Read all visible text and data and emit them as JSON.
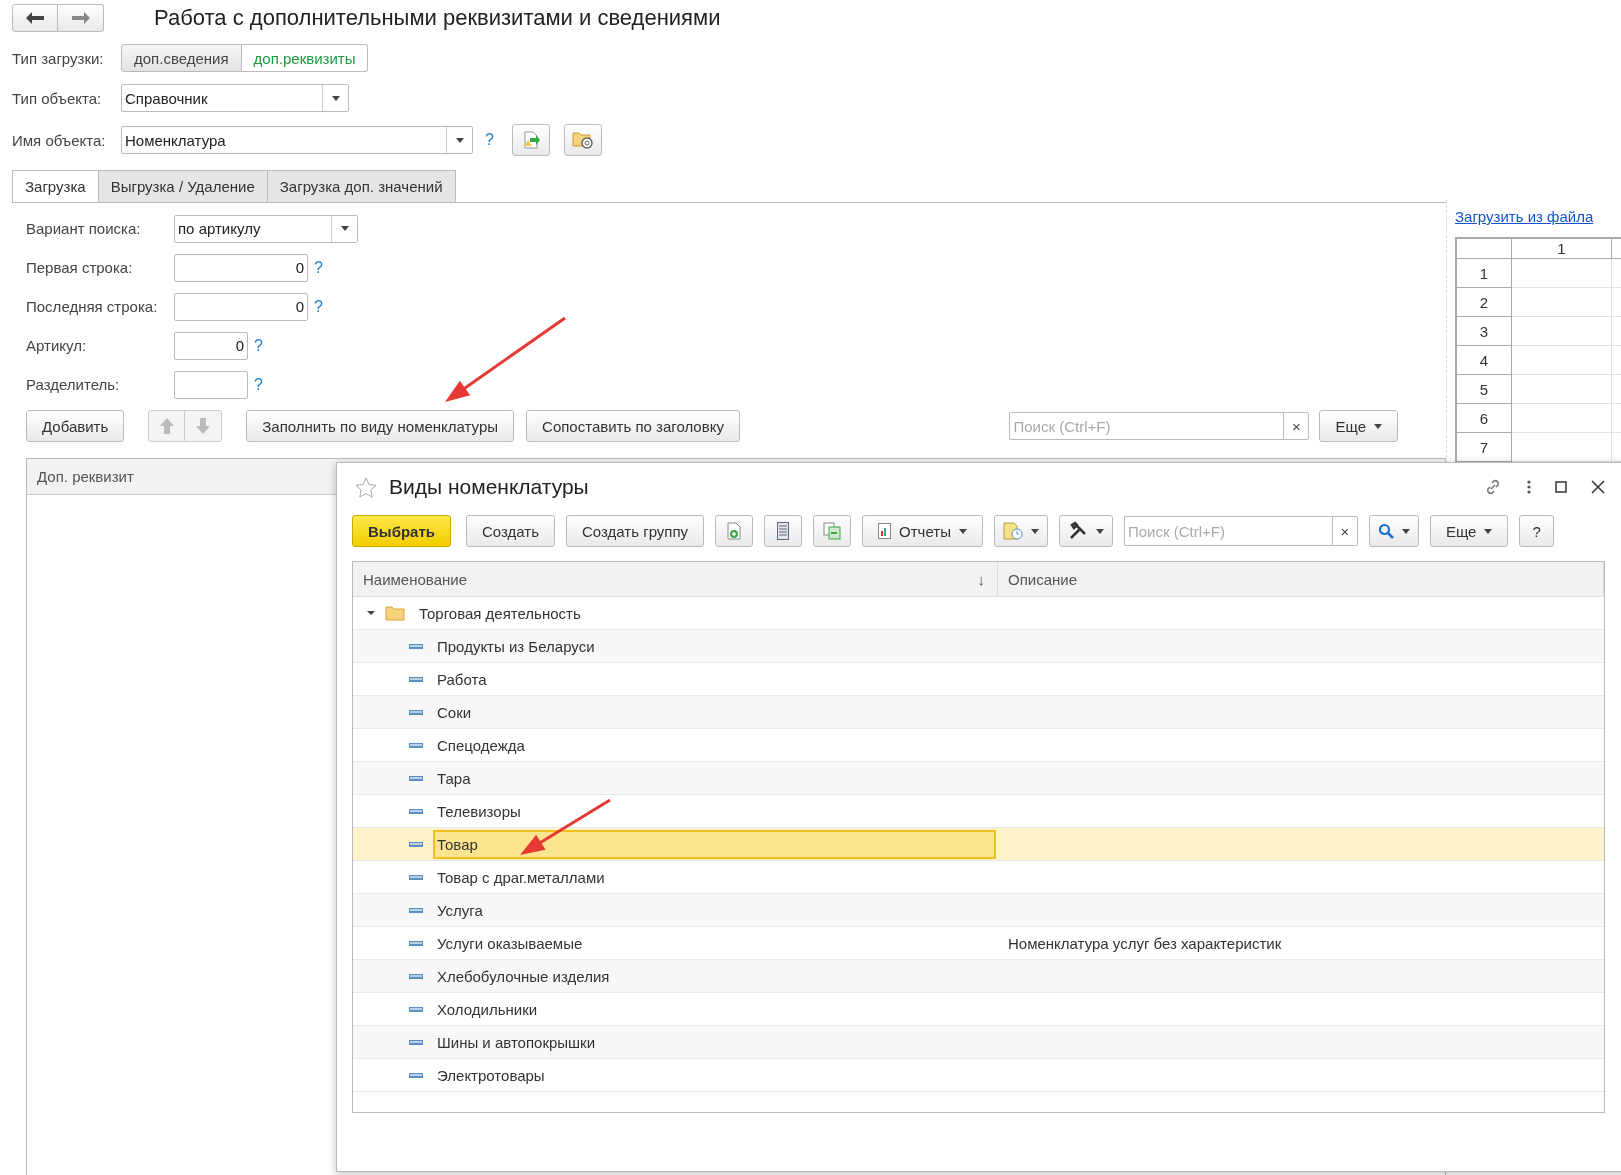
{
  "window": {
    "title": "Работа с дополнительными реквизитами и сведениями"
  },
  "load_type": {
    "label": "Тип загрузки:",
    "options": [
      {
        "label": "доп.сведения",
        "selected": false
      },
      {
        "label": "доп.реквизиты",
        "selected": true
      }
    ]
  },
  "object_type": {
    "label": "Тип объекта:",
    "value": "Справочник"
  },
  "object_name": {
    "label": "Имя объекта:",
    "value": "Номенклатура",
    "help": "?"
  },
  "tabs": [
    {
      "label": "Загрузка",
      "selected": true
    },
    {
      "label": "Выгрузка / Удаление",
      "selected": false
    },
    {
      "label": "Загрузка доп. значений",
      "selected": false
    }
  ],
  "fields": [
    {
      "kind": "select",
      "label": "Вариант поиска:",
      "value": "по артикулу"
    },
    {
      "kind": "number",
      "label": "Первая строка:",
      "value": "0",
      "help": "?"
    },
    {
      "kind": "number",
      "label": "Последняя строка:",
      "value": "0",
      "help": "?"
    },
    {
      "kind": "short",
      "label": "Артикул:",
      "value": "0",
      "help": "?"
    },
    {
      "kind": "short",
      "label": "Разделитель:",
      "help": "?"
    }
  ],
  "actions": {
    "add": "Добавить",
    "fill": "Заполнить по виду номенклатуры",
    "match": "Сопоставить по заголовку"
  },
  "search": {
    "placeholder": "Поиск (Ctrl+F)",
    "clear": "×"
  },
  "more": "Еще",
  "table": {
    "columns": [
      "Доп. реквизит"
    ]
  },
  "sheet": {
    "link": "Загрузить из файла",
    "column": "1",
    "rows": [
      "1",
      "2",
      "3",
      "4",
      "5",
      "6",
      "7"
    ]
  },
  "dialog": {
    "title": "Виды номенклатуры",
    "toolbar": {
      "choose": "Выбрать",
      "create": "Создать",
      "create_group": "Создать группу",
      "reports": "Отчеты",
      "more": "Еще",
      "help": "?"
    },
    "search": {
      "placeholder": "Поиск (Ctrl+F)",
      "clear": "×"
    },
    "columns": [
      "Наименование",
      "Описание"
    ],
    "sort": "↓",
    "tree": [
      {
        "name": "Торговая деятельность",
        "expanded": true,
        "children": [
          {
            "name": "Продукты из Беларуси",
            "selected": false
          },
          {
            "name": "Работа",
            "selected": false
          },
          {
            "name": "Соки",
            "selected": false
          },
          {
            "name": "Спецодежда",
            "selected": false
          },
          {
            "name": "Тара",
            "selected": false
          },
          {
            "name": "Телевизоры",
            "selected": false
          },
          {
            "name": "Товар",
            "selected": true
          },
          {
            "name": "Товар с драг.металлами",
            "selected": false
          },
          {
            "name": "Услуга",
            "selected": false
          },
          {
            "name": "Услуги оказываемые",
            "description": "Номенклатура услуг без характеристик",
            "selected": false
          },
          {
            "name": "Хлебобулочные изделия",
            "selected": false
          },
          {
            "name": "Холодильники",
            "selected": false
          },
          {
            "name": "Шины и автопокрышки",
            "selected": false
          },
          {
            "name": "Электротовары",
            "selected": false
          }
        ]
      }
    ]
  }
}
